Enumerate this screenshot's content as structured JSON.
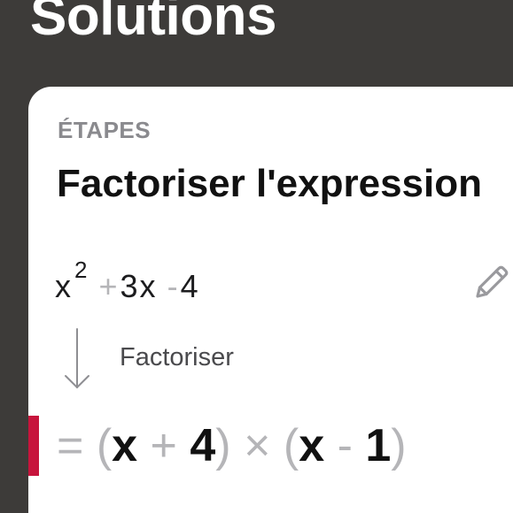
{
  "page": {
    "heading": "Solutions"
  },
  "card": {
    "section_label": "ÉTAPES",
    "step_title": "Factoriser l'expression",
    "expression": {
      "base": "x",
      "exponent": "2",
      "plus": "+",
      "coef": "3",
      "var": "x",
      "minus": "-",
      "constant": "4"
    },
    "edit_icon": "pencil-icon",
    "arrow_icon": "arrow-down-icon",
    "step_action": "Factoriser",
    "result": {
      "equals": "=",
      "open1": "(",
      "var1": "x",
      "op1": "+",
      "num1": "4",
      "close1": ")",
      "times": "×",
      "open2": "(",
      "var2": "x",
      "op2": "-",
      "num2": "1",
      "close2": ")"
    },
    "accent_color": "#c7143c"
  }
}
